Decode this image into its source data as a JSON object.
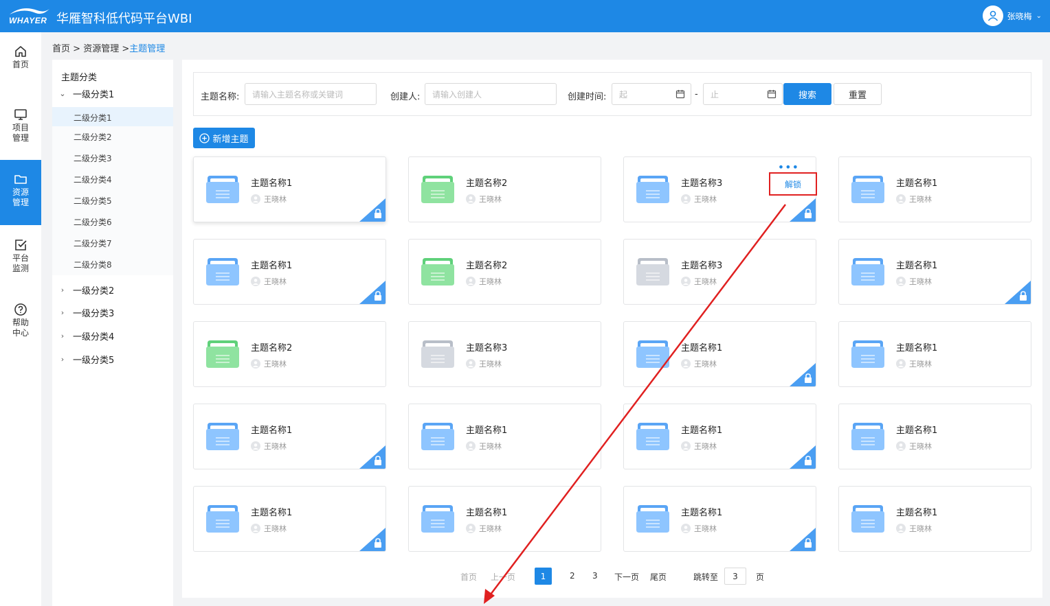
{
  "app": {
    "logo_text": "WHAYER",
    "title": "华雁智科低代码平台WBI",
    "user_name": "张晓梅"
  },
  "nav": [
    {
      "label1": "首页",
      "label2": "",
      "icon": "home-icon"
    },
    {
      "label1": "项目",
      "label2": "管理",
      "icon": "monitor-icon"
    },
    {
      "label1": "资源",
      "label2": "管理",
      "icon": "folder-icon",
      "active": true
    },
    {
      "label1": "平台",
      "label2": "监测",
      "icon": "check-square-icon"
    },
    {
      "label1": "帮助",
      "label2": "中心",
      "icon": "help-icon"
    }
  ],
  "breadcrumb": {
    "home": "首页",
    "sep1": ">",
    "resources": "资源管理",
    "sep2": ">",
    "current": "主题管理"
  },
  "categories": {
    "title": "主题分类",
    "groups": [
      "一级分类1",
      "一级分类2",
      "一级分类3",
      "一级分类4",
      "一级分类5"
    ],
    "sub": [
      "二级分类1",
      "二级分类2",
      "二级分类3",
      "二级分类4",
      "二级分类5",
      "二级分类6",
      "二级分类7",
      "二级分类8"
    ],
    "selected_sub": "二级分类1"
  },
  "filter": {
    "name_label": "主题名称:",
    "name_placeholder": "请输入主题名称或关键词",
    "creator_label": "创建人:",
    "creator_placeholder": "请输入创建人",
    "time_label": "创建时间:",
    "start_placeholder": "起",
    "dash": "-",
    "end_placeholder": "止",
    "search": "搜索",
    "reset": "重置"
  },
  "add_button": "新增主题",
  "unlock_label": "解锁",
  "colors": {
    "accent": "#1e88e5",
    "blue_folder": "#8ec5ff",
    "green_folder": "#8fe3a0",
    "gray_folder": "#d5d9e0",
    "highlight": "#e02020"
  },
  "cards": [
    {
      "name": "主题名称1",
      "creator": "王晓林",
      "color": "blue",
      "locked": true
    },
    {
      "name": "主题名称2",
      "creator": "王晓林",
      "color": "green",
      "locked": false
    },
    {
      "name": "主题名称3",
      "creator": "王晓林",
      "color": "blue",
      "locked": true,
      "menu": true
    },
    {
      "name": "主题名称1",
      "creator": "王晓林",
      "color": "blue",
      "locked": false
    },
    {
      "name": "主题名称1",
      "creator": "王晓林",
      "color": "blue",
      "locked": true
    },
    {
      "name": "主题名称2",
      "creator": "王晓林",
      "color": "green",
      "locked": false
    },
    {
      "name": "主题名称3",
      "creator": "王晓林",
      "color": "gray",
      "locked": false
    },
    {
      "name": "主题名称1",
      "creator": "王晓林",
      "color": "blue",
      "locked": true
    },
    {
      "name": "主题名称2",
      "creator": "王晓林",
      "color": "green",
      "locked": false
    },
    {
      "name": "主题名称3",
      "creator": "王晓林",
      "color": "gray",
      "locked": false
    },
    {
      "name": "主题名称1",
      "creator": "王晓林",
      "color": "blue",
      "locked": true
    },
    {
      "name": "主题名称1",
      "creator": "王晓林",
      "color": "blue",
      "locked": false
    },
    {
      "name": "主题名称1",
      "creator": "王晓林",
      "color": "blue",
      "locked": true
    },
    {
      "name": "主题名称1",
      "creator": "王晓林",
      "color": "blue",
      "locked": false
    },
    {
      "name": "主题名称1",
      "creator": "王晓林",
      "color": "blue",
      "locked": true
    },
    {
      "name": "主题名称1",
      "creator": "王晓林",
      "color": "blue",
      "locked": false
    },
    {
      "name": "主题名称1",
      "creator": "王晓林",
      "color": "blue",
      "locked": true
    },
    {
      "name": "主题名称1",
      "creator": "王晓林",
      "color": "blue",
      "locked": false
    },
    {
      "name": "主题名称1",
      "creator": "王晓林",
      "color": "blue",
      "locked": true
    },
    {
      "name": "主题名称1",
      "creator": "王晓林",
      "color": "blue",
      "locked": false
    }
  ],
  "pagination": {
    "first": "首页",
    "prev": "上一页",
    "pages": [
      "1",
      "2",
      "3"
    ],
    "current": "1",
    "next": "下一页",
    "last": "尾页",
    "jump_label": "跳转至",
    "jump_value": "3",
    "page_suffix": "页"
  }
}
